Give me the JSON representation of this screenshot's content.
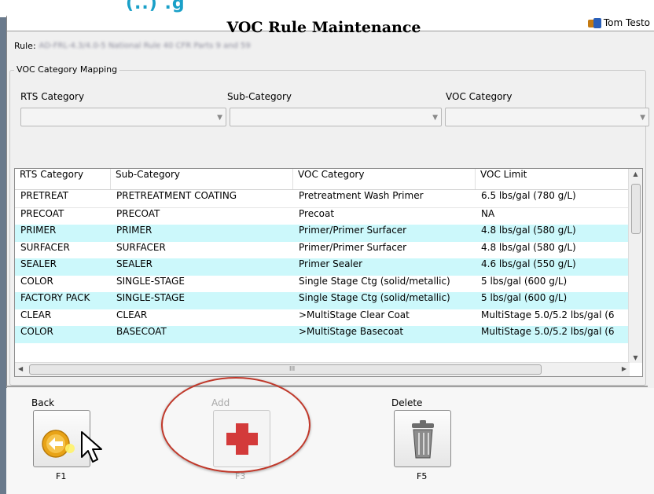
{
  "window": {
    "user_name": "Tom Testo",
    "title": "VOC Rule Maintenance",
    "rule_label": "Rule:",
    "rule_value": "AD-FRL-4.3/4.0-5 National Rule 40 CFR Parts 9 and 59"
  },
  "mapping": {
    "group_label": "VOC Category Mapping",
    "rts_category_label": "RTS Category",
    "sub_category_label": "Sub-Category",
    "voc_category_label": "VOC Category",
    "rts_category_value": "",
    "sub_category_value": "",
    "voc_category_value": ""
  },
  "table": {
    "headers": [
      "RTS Category",
      "Sub-Category",
      "VOC Category",
      "VOC Limit"
    ],
    "rows": [
      [
        "PRETREAT",
        "PRETREATMENT COATING",
        "Pretreatment Wash Primer",
        "6.5 lbs/gal (780 g/L)"
      ],
      [
        "PRECOAT",
        "PRECOAT",
        "Precoat",
        "NA"
      ],
      [
        "PRIMER",
        "PRIMER",
        "Primer/Primer Surfacer",
        "4.8 lbs/gal (580 g/L)"
      ],
      [
        "SURFACER",
        "SURFACER",
        "Primer/Primer Surfacer",
        "4.8 lbs/gal (580 g/L)"
      ],
      [
        "SEALER",
        "SEALER",
        "Primer Sealer",
        "4.6 lbs/gal (550 g/L)"
      ],
      [
        "COLOR",
        "SINGLE-STAGE",
        "Single Stage Ctg (solid/metallic)",
        "5 lbs/gal (600 g/L)"
      ],
      [
        "FACTORY PACK",
        "SINGLE-STAGE",
        "Single Stage Ctg (solid/metallic)",
        "5 lbs/gal (600 g/L)"
      ],
      [
        "CLEAR",
        "CLEAR",
        ">MultiStage Clear Coat",
        "MultiStage 5.0/5.2 lbs/gal (6"
      ],
      [
        "COLOR",
        "BASECOAT",
        ">MultiStage Basecoat",
        "MultiStage 5.0/5.2 lbs/gal (6"
      ]
    ],
    "hscroll_grip": "III"
  },
  "toolbar": {
    "back_label": "Back",
    "back_key": "F1",
    "add_label": "Add",
    "add_key": "F3",
    "delete_label": "Delete",
    "delete_key": "F5"
  },
  "icons": {
    "back": "arrow-left-circle-icon",
    "add": "red-cross-plus-icon",
    "delete": "trash-can-icon"
  },
  "colors": {
    "alt_row": "#ccf8fb",
    "highlight_oval": "#c0392b",
    "back_icon": "#e8a317",
    "add_icon": "#d33a3a"
  }
}
